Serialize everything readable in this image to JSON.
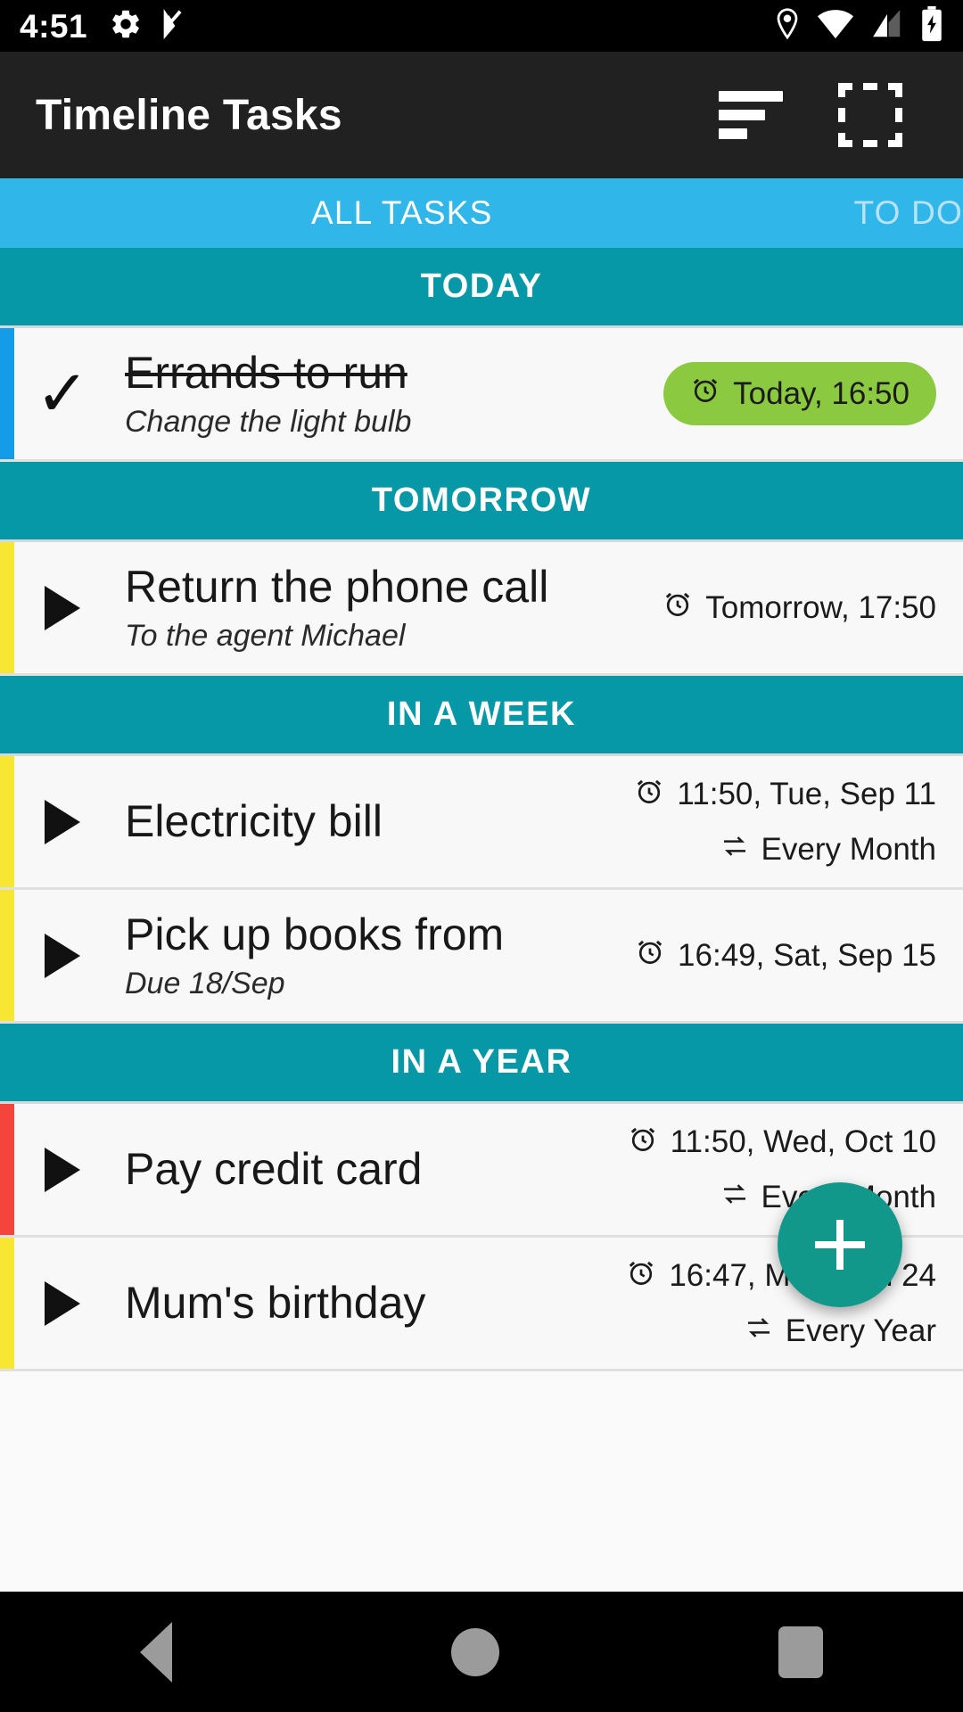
{
  "status_bar": {
    "time": "4:51",
    "left_icons": [
      "gear-icon",
      "checkmark-flag-icon"
    ],
    "right_icons": [
      "location-pin-icon",
      "wifi-icon",
      "cellular-signal-icon",
      "battery-charging-icon"
    ]
  },
  "app_bar": {
    "title": "Timeline Tasks",
    "actions": [
      {
        "name": "sort-button",
        "icon": "sort-icon"
      },
      {
        "name": "select-mode-button",
        "icon": "dashed-square-select-icon"
      }
    ]
  },
  "tabs": {
    "active_index": 0,
    "items": [
      {
        "label": "ALL TASKS",
        "active": true
      },
      {
        "label": "TO DO",
        "active": false
      }
    ]
  },
  "colors": {
    "accent_teal": "#0798A8",
    "tab_bar": "#30B6E8",
    "fab": "#12988B",
    "badge_green": "#8BC940",
    "stripe_blue": "#149CE8",
    "stripe_yellow": "#F7E733",
    "stripe_red": "#F4443C",
    "app_bar": "#212121"
  },
  "sections": [
    {
      "header": "TODAY",
      "tasks": [
        {
          "marker": "check",
          "stripe": "#149CE8",
          "title": "Errands to run",
          "completed": true,
          "subtitle": "Change the light bulb",
          "due": "Today, 16:50",
          "due_highlighted": true,
          "repeat": null
        }
      ]
    },
    {
      "header": "TOMORROW",
      "tasks": [
        {
          "marker": "arrow",
          "stripe": "#F7E733",
          "title": "Return the phone call",
          "completed": false,
          "subtitle": "To the agent Michael",
          "due": "Tomorrow, 17:50",
          "due_highlighted": false,
          "repeat": null
        }
      ]
    },
    {
      "header": "IN A WEEK",
      "tasks": [
        {
          "marker": "arrow",
          "stripe": "#F7E733",
          "title": "Electricity bill",
          "completed": false,
          "subtitle": null,
          "due": "11:50, Tue, Sep 11",
          "due_highlighted": false,
          "repeat": "Every Month"
        },
        {
          "marker": "arrow",
          "stripe": "#F7E733",
          "title": "Pick up books from",
          "completed": false,
          "subtitle": "Due 18/Sep",
          "due": "16:49, Sat, Sep 15",
          "due_highlighted": false,
          "repeat": null
        }
      ]
    },
    {
      "header": "IN A YEAR",
      "tasks": [
        {
          "marker": "arrow",
          "stripe": "#F4443C",
          "title": "Pay credit card",
          "completed": false,
          "subtitle": null,
          "due": "11:50, Wed, Oct 10",
          "due_highlighted": false,
          "repeat": "Every Month"
        },
        {
          "marker": "arrow",
          "stripe": "#F7E733",
          "title": "Mum's birthday",
          "completed": false,
          "subtitle": null,
          "due": "16:47, Mon, Jun 24",
          "due_highlighted": false,
          "repeat": "Every Year"
        }
      ]
    }
  ],
  "fab": {
    "name": "add-task-button",
    "icon": "plus-icon"
  },
  "nav_bar": {
    "items": [
      {
        "name": "nav-back-button",
        "icon": "back-triangle-icon"
      },
      {
        "name": "nav-home-button",
        "icon": "home-circle-icon"
      },
      {
        "name": "nav-recents-button",
        "icon": "recents-square-icon"
      }
    ]
  }
}
